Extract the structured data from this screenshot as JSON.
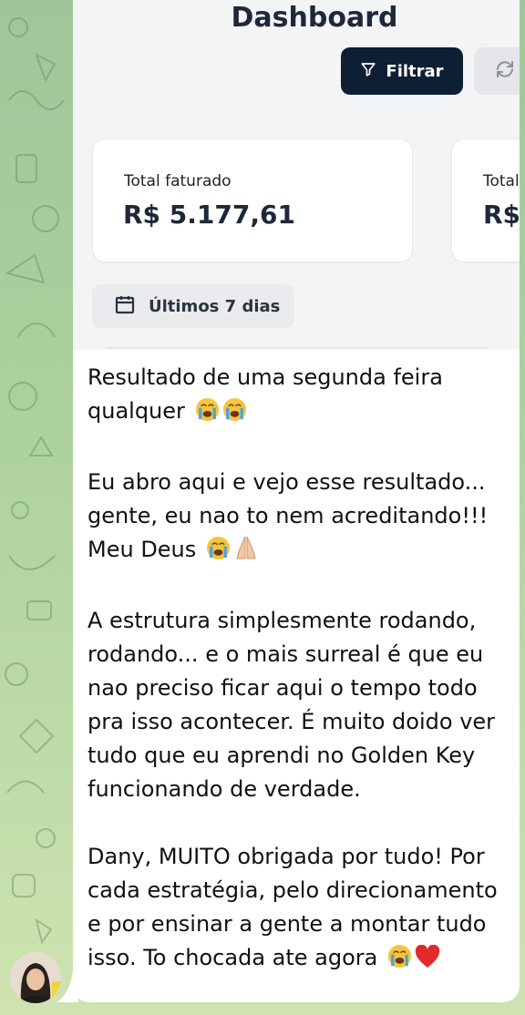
{
  "screenshot": {
    "title": "Dashboard",
    "filter_button_label": "Filtrar",
    "cards": [
      {
        "label": "Total faturado",
        "value": "R$ 5.177,61"
      },
      {
        "label": "Total",
        "value": "R$"
      }
    ],
    "date_range": "Últimos 7 dias",
    "icons": {
      "filter": "funnel-icon",
      "refresh": "refresh-icon",
      "calendar": "calendar-icon"
    },
    "colors": {
      "filter_button_bg": "#0e1e33",
      "title": "#1d2939"
    }
  },
  "message": {
    "paragraphs": [
      {
        "lines": [
          "Resultado de uma segunda feira",
          "qualquer"
        ],
        "emojis": [
          "loudly-crying-face-icon",
          "loudly-crying-face-icon"
        ]
      },
      {
        "lines": [
          "Eu abro aqui e vejo esse resultado...",
          "gente, eu nao to nem acreditando!!!",
          "Meu Deus"
        ],
        "emojis": [
          "loudly-crying-face-icon",
          "folded-hands-icon"
        ]
      },
      {
        "lines": [
          "A estrutura simplesmente rodando,",
          "rodando... e o mais surreal é que eu",
          "nao preciso ficar aqui o tempo todo",
          "pra isso acontecer. É muito doido ver",
          "tudo que eu aprendi no Golden Key",
          "funcionando de verdade."
        ]
      },
      {
        "lines": [
          "Dany, MUITO obrigada por tudo! Por",
          "cada estratégia, pelo direcionamento",
          "e por ensinar a gente a montar tudo",
          "isso. To chocada ate agora"
        ],
        "emojis": [
          "loudly-crying-face-icon",
          "red-heart-icon"
        ]
      }
    ]
  },
  "sender": {
    "avatar": "avatar"
  },
  "colors": {
    "chat_background": "#a9cf9c",
    "bubble": "#ffffff"
  }
}
